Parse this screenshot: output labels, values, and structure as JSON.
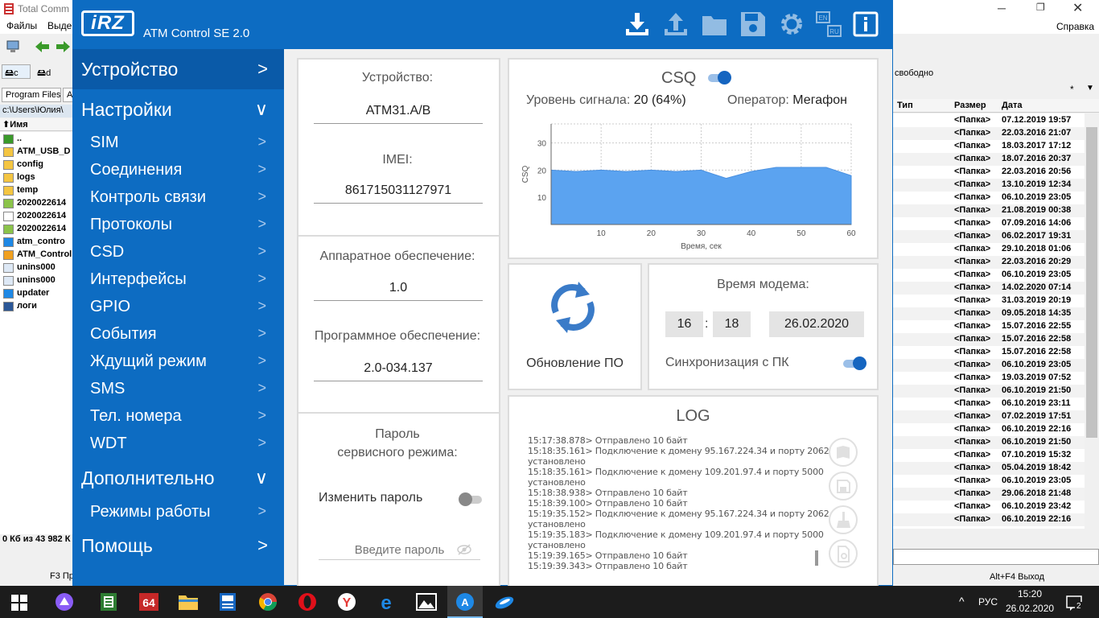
{
  "tc": {
    "title": "Total Comm",
    "menu": [
      "Файлы",
      "Выде"
    ],
    "help": "Справка",
    "drives": [
      "c",
      "d"
    ],
    "left_tabs": [
      "Program Files",
      "A"
    ],
    "left_path": "c:\\Users\\Юлия\\",
    "left_header": "Имя",
    "left_files": [
      "..",
      "ATM_USB_D",
      "config",
      "logs",
      "temp",
      "2020022614",
      "2020022614",
      "2020022614",
      "atm_contro",
      "ATM_Control",
      "unins000",
      "unins000",
      "updater",
      "логи"
    ],
    "left_status": "0 Кб из 43 982 К",
    "f3": "F3 Пр",
    "right_free": "свободно",
    "right_star": "*",
    "right_headers": [
      "Тип",
      "Размер",
      "Дата"
    ],
    "right_rows": [
      {
        "size": "<Папка>",
        "date": "07.12.2019 19:57"
      },
      {
        "size": "<Папка>",
        "date": "22.03.2016 21:07"
      },
      {
        "size": "<Папка>",
        "date": "18.03.2017 17:12"
      },
      {
        "size": "<Папка>",
        "date": "18.07.2016 20:37"
      },
      {
        "size": "<Папка>",
        "date": "22.03.2016 20:56"
      },
      {
        "size": "<Папка>",
        "date": "13.10.2019 12:34"
      },
      {
        "size": "<Папка>",
        "date": "06.10.2019 23:05"
      },
      {
        "size": "<Папка>",
        "date": "21.08.2019 00:38"
      },
      {
        "size": "<Папка>",
        "date": "07.09.2016 14:06"
      },
      {
        "size": "<Папка>",
        "date": "06.02.2017 19:31"
      },
      {
        "size": "<Папка>",
        "date": "29.10.2018 01:06"
      },
      {
        "size": "<Папка>",
        "date": "22.03.2016 20:29"
      },
      {
        "size": "<Папка>",
        "date": "06.10.2019 23:05"
      },
      {
        "size": "<Папка>",
        "date": "14.02.2020 07:14"
      },
      {
        "size": "<Папка>",
        "date": "31.03.2019 20:19"
      },
      {
        "size": "<Папка>",
        "date": "09.05.2018 14:35"
      },
      {
        "size": "<Папка>",
        "date": "15.07.2016 22:55"
      },
      {
        "size": "<Папка>",
        "date": "15.07.2016 22:58"
      },
      {
        "size": "<Папка>",
        "date": "15.07.2016 22:58"
      },
      {
        "size": "<Папка>",
        "date": "06.10.2019 23:05"
      },
      {
        "size": "<Папка>",
        "date": "19.03.2019 07:52"
      },
      {
        "size": "<Папка>",
        "date": "06.10.2019 21:50"
      },
      {
        "size": "<Папка>",
        "date": "06.10.2019 23:11"
      },
      {
        "size": "<Папка>",
        "date": "07.02.2019 17:51"
      },
      {
        "size": "<Папка>",
        "date": "06.10.2019 22:16"
      },
      {
        "size": "<Папка>",
        "date": "06.10.2019 21:50"
      },
      {
        "size": "<Папка>",
        "date": "07.10.2019 15:32"
      },
      {
        "size": "<Папка>",
        "date": "05.04.2019 18:42"
      },
      {
        "size": "<Папка>",
        "date": "06.10.2019 23:05"
      },
      {
        "size": "<Папка>",
        "date": "29.06.2018 21:48"
      },
      {
        "size": "<Папка>",
        "date": "06.10.2019 23:42"
      },
      {
        "size": "<Папка>",
        "date": "06.10.2019 22:16"
      }
    ],
    "alt_f4": "Alt+F4 Выход"
  },
  "app": {
    "logo": "iRZ",
    "title": "ATM Control SE 2.0",
    "header_icons": [
      "download-icon",
      "upload-icon",
      "folder-icon",
      "save-icon",
      "settings-icon",
      "language-icon",
      "info-icon"
    ],
    "lang_en": "EN",
    "lang_ru": "RU"
  },
  "nav": {
    "device": "Устройство",
    "settings": "Настройки",
    "settings_items": [
      "SIM",
      "Соединения",
      "Контроль связи",
      "Протоколы",
      "CSD",
      "Интерфейсы",
      "GPIO",
      "События",
      "Ждущий режим",
      "SMS",
      "Тел. номера",
      "WDT"
    ],
    "additional": "Дополнительно",
    "additional_items": [
      "Режимы работы"
    ],
    "help": "Помощь",
    "chevron_right": ">",
    "chevron_down": "∨"
  },
  "device": {
    "device_label": "Устройство:",
    "device_value": "ATM31.A/B",
    "imei_label": "IMEI:",
    "imei_value": "861715031127971",
    "hw_label": "Аппаратное обеспечение:",
    "hw_value": "1.0",
    "sw_label": "Программное обеспечение:",
    "sw_value": "2.0-034.137",
    "pwd_label_1": "Пароль",
    "pwd_label_2": "сервисного режима:",
    "change_pwd": "Изменить пароль",
    "change_pwd_on": false,
    "pwd_placeholder": "Введите пароль"
  },
  "csq": {
    "title": "CSQ",
    "enabled": true,
    "signal_label": "Уровень сигнала:",
    "signal_value": "20 (64%)",
    "operator_label": "Оператор:",
    "operator_value": "Мегафон"
  },
  "chart_data": {
    "type": "area",
    "xlabel": "Время, сек",
    "ylabel": "CSQ",
    "xlim": [
      0,
      60
    ],
    "ylim": [
      0,
      37
    ],
    "xticks": [
      10,
      20,
      30,
      40,
      50,
      60
    ],
    "yticks": [
      10,
      20,
      30
    ],
    "grid": true,
    "color": "#5ba3f0",
    "x": [
      0,
      5,
      10,
      15,
      20,
      25,
      30,
      35,
      40,
      45,
      50,
      55,
      60
    ],
    "y": [
      20,
      19.5,
      20,
      19.5,
      20,
      19.5,
      20,
      17,
      19.5,
      21,
      21,
      21,
      18
    ]
  },
  "update": {
    "label": "Обновление ПО"
  },
  "modem_time": {
    "title": "Время модема:",
    "hour": "16",
    "sep": ":",
    "minute": "18",
    "date": "26.02.2020",
    "sync_label": "Синхронизация с ПК",
    "sync_on": true
  },
  "log": {
    "title": "LOG",
    "lines": [
      "15:17:38.878> Отправлено 10 байт",
      "15:18:35.161> Подключение к домену 95.167.224.34 и порту 2062",
      "установлено",
      "15:18:35.161> Подключение к домену 109.201.97.4 и порту 5000",
      "установлено",
      "15:18:38.938> Отправлено 10 байт",
      "15:18:39.100> Отправлено 10 байт",
      "15:19:35.152> Подключение к домену 95.167.224.34 и порту 2062",
      "установлено",
      "15:19:35.183> Подключение к домену 109.201.97.4 и порту 5000",
      "установлено",
      "15:19:39.165> Отправлено 10 байт",
      "15:19:39.343> Отправлено 10 байт"
    ]
  },
  "taskbar": {
    "lang": "РУС",
    "time": "15:20",
    "date": "26.02.2020",
    "notif_count": "2"
  }
}
